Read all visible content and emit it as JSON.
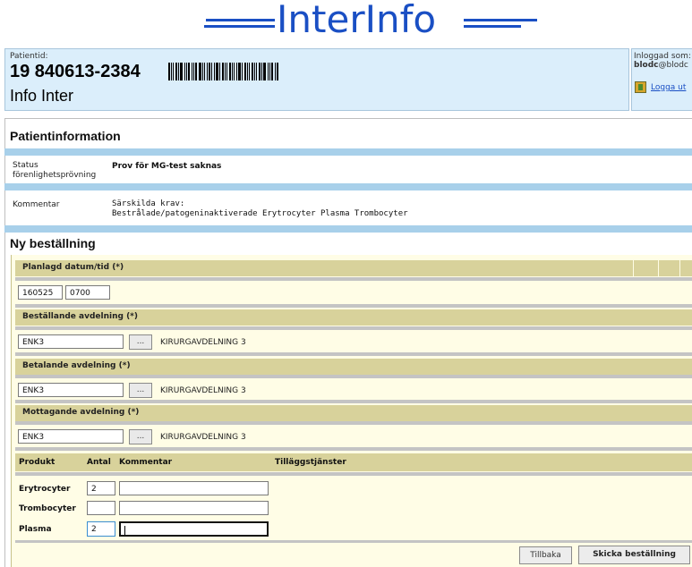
{
  "logo": {
    "text": "InterInfo"
  },
  "patient": {
    "label": "Patientid:",
    "id": "19 840613-2384",
    "name": "Info Inter"
  },
  "login": {
    "label": "Inloggad som:",
    "user_bold": "blodc",
    "user_rest": "@blodc",
    "logout": "Logga ut"
  },
  "patient_info": {
    "title": "Patientinformation",
    "status_label": "Status förenlighetsprövning",
    "status_value": "Prov för MG-test saknas",
    "comment_label": "Kommentar",
    "comment_line1": "Särskilda krav:",
    "comment_line2": "Bestrålade/patogeninaktiverade Erytrocyter Plasma Trombocyter"
  },
  "order": {
    "title": "Ny beställning",
    "planned_label": "Planlagd datum/tid (*)",
    "date_value": "160525",
    "time_value": "0700",
    "ordering_label": "Beställande avdelning (*)",
    "ordering_code": "ENK3",
    "ordering_name": "KIRURGAVDELNING 3",
    "paying_label": "Betalande avdelning (*)",
    "paying_code": "ENK3",
    "paying_name": "KIRURGAVDELNING 3",
    "receiving_label": "Mottagande avdelning (*)",
    "receiving_code": "ENK3",
    "receiving_name": "KIRURGAVDELNING 3",
    "lookup_label": "...",
    "columns": [
      "Produkt",
      "Antal",
      "Kommentar",
      "Tilläggstjänster"
    ],
    "products": [
      {
        "name": "Erytrocyter",
        "qty": "2",
        "comment": ""
      },
      {
        "name": "Trombocyter",
        "qty": "",
        "comment": ""
      },
      {
        "name": "Plasma",
        "qty": "2",
        "comment": ""
      }
    ],
    "back_button": "Tillbaka",
    "submit_button": "Skicka beställning"
  }
}
